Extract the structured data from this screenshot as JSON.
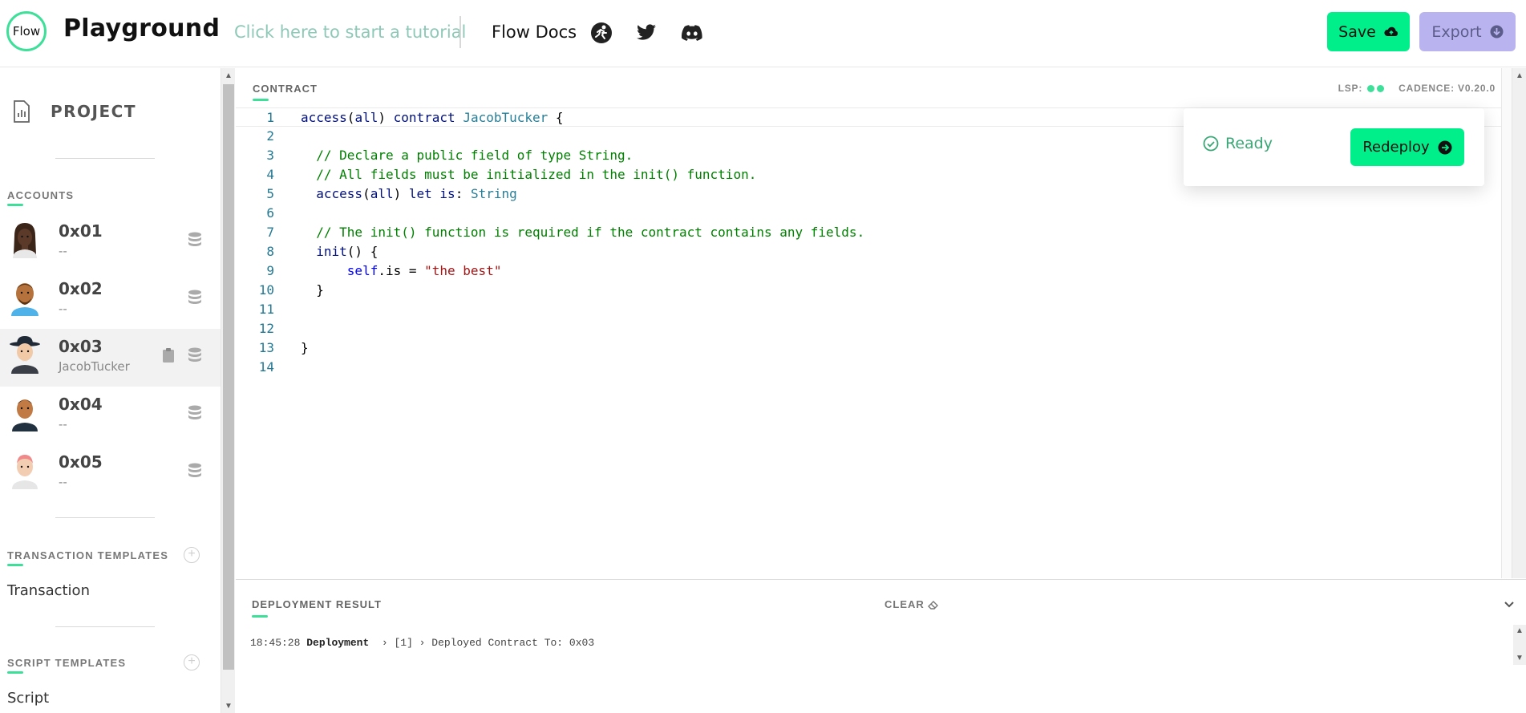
{
  "header": {
    "logo_text": "Flow",
    "app_title": "Playground",
    "tutorial_link": "Click here to start a tutorial",
    "docs_link": "Flow Docs",
    "social_icons": [
      "flow-runner-icon",
      "twitter-icon",
      "discord-icon"
    ],
    "save_label": "Save",
    "export_label": "Export"
  },
  "sidebar": {
    "project_label": "PROJECT",
    "accounts_title": "ACCOUNTS",
    "accounts": [
      {
        "address": "0x01",
        "name": "--"
      },
      {
        "address": "0x02",
        "name": "--"
      },
      {
        "address": "0x03",
        "name": "JacobTucker",
        "active": true
      },
      {
        "address": "0x04",
        "name": "--"
      },
      {
        "address": "0x05",
        "name": "--"
      }
    ],
    "transaction_templates_title": "TRANSACTION TEMPLATES",
    "transaction_templates": [
      "Transaction"
    ],
    "script_templates_title": "SCRIPT TEMPLATES",
    "script_templates": [
      "Script"
    ]
  },
  "editor": {
    "section_label": "CONTRACT",
    "lsp_label": "LSP:",
    "cadence_label": "CADENCE: V0.20.0",
    "line_numbers": [
      "1",
      "2",
      "3",
      "4",
      "5",
      "6",
      "7",
      "8",
      "9",
      "10",
      "11",
      "12",
      "13",
      "14"
    ]
  },
  "status_panel": {
    "status": "Ready",
    "redeploy_label": "Redeploy"
  },
  "deployment": {
    "title": "DEPLOYMENT RESULT",
    "clear_label": "CLEAR",
    "log": {
      "time": "18:45:28",
      "kind": "Deployment",
      "count": "[1]",
      "message": "Deployed Contract To: 0x03"
    }
  },
  "colors": {
    "accent": "#00ef8b",
    "accent_light": "#3ee099",
    "export_bg": "#b9b4ef"
  }
}
